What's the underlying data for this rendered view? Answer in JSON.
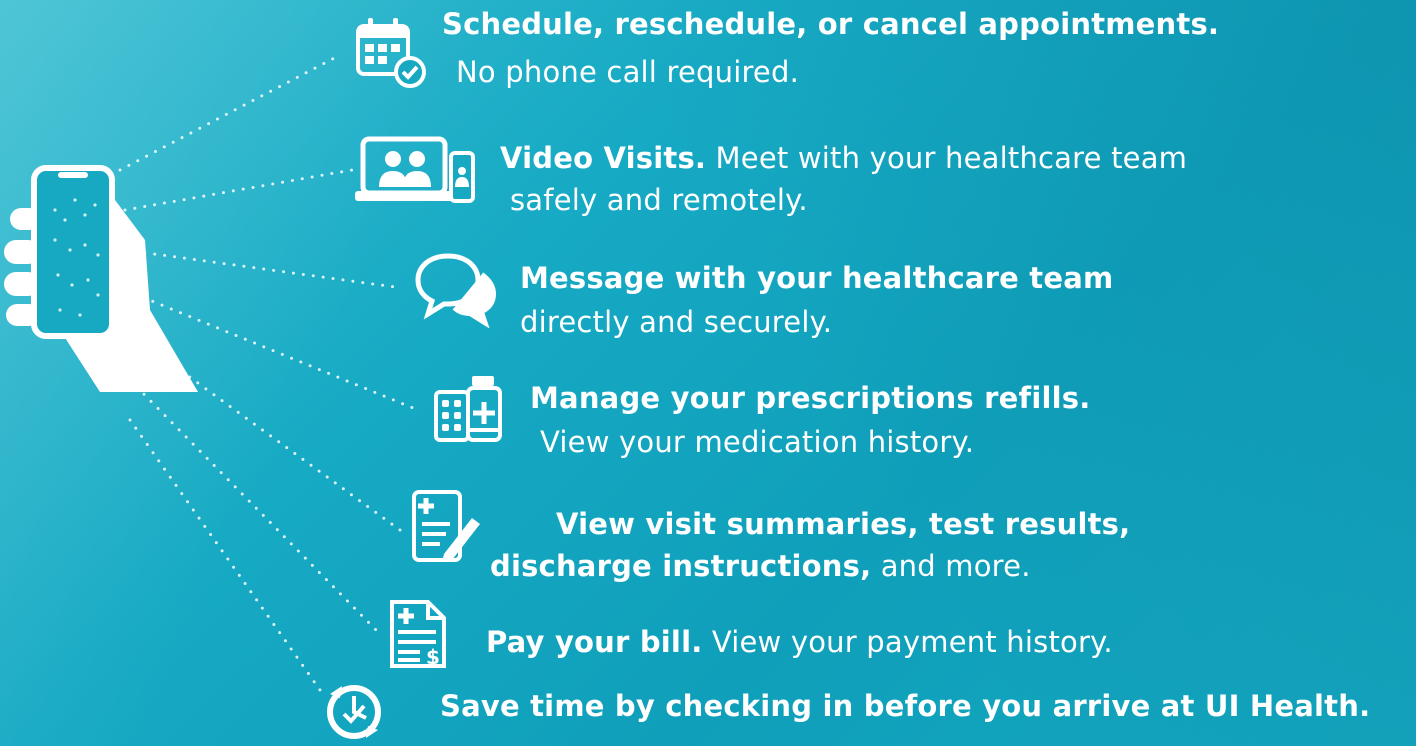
{
  "colors": {
    "background": "#14a6bf",
    "foreground": "#ffffff"
  },
  "features": [
    {
      "icon": "calendar-check-icon",
      "bold": "Schedule, reschedule, or cancel appointments.",
      "rest": "",
      "line2": "No phone call required."
    },
    {
      "icon": "video-visit-icon",
      "bold": "Video Visits.",
      "rest": " Meet with your healthcare team",
      "line2": "safely and remotely."
    },
    {
      "icon": "chat-bubbles-icon",
      "bold": "Message with your healthcare team",
      "rest": "",
      "line2": "directly and securely."
    },
    {
      "icon": "prescription-icon",
      "bold": "Manage your prescriptions refills.",
      "rest": "",
      "line2": "View your medication history."
    },
    {
      "icon": "medical-document-icon",
      "bold": "View visit summaries, test results,",
      "rest": "",
      "line2_bold": "discharge instructions,",
      "line2": " and more."
    },
    {
      "icon": "bill-icon",
      "bold": "Pay your bill.",
      "rest": " View your payment history.",
      "line2": ""
    },
    {
      "icon": "clock-checkin-icon",
      "bold": "Save time by checking in before you arrive at UI Health.",
      "rest": "",
      "line2": ""
    }
  ]
}
